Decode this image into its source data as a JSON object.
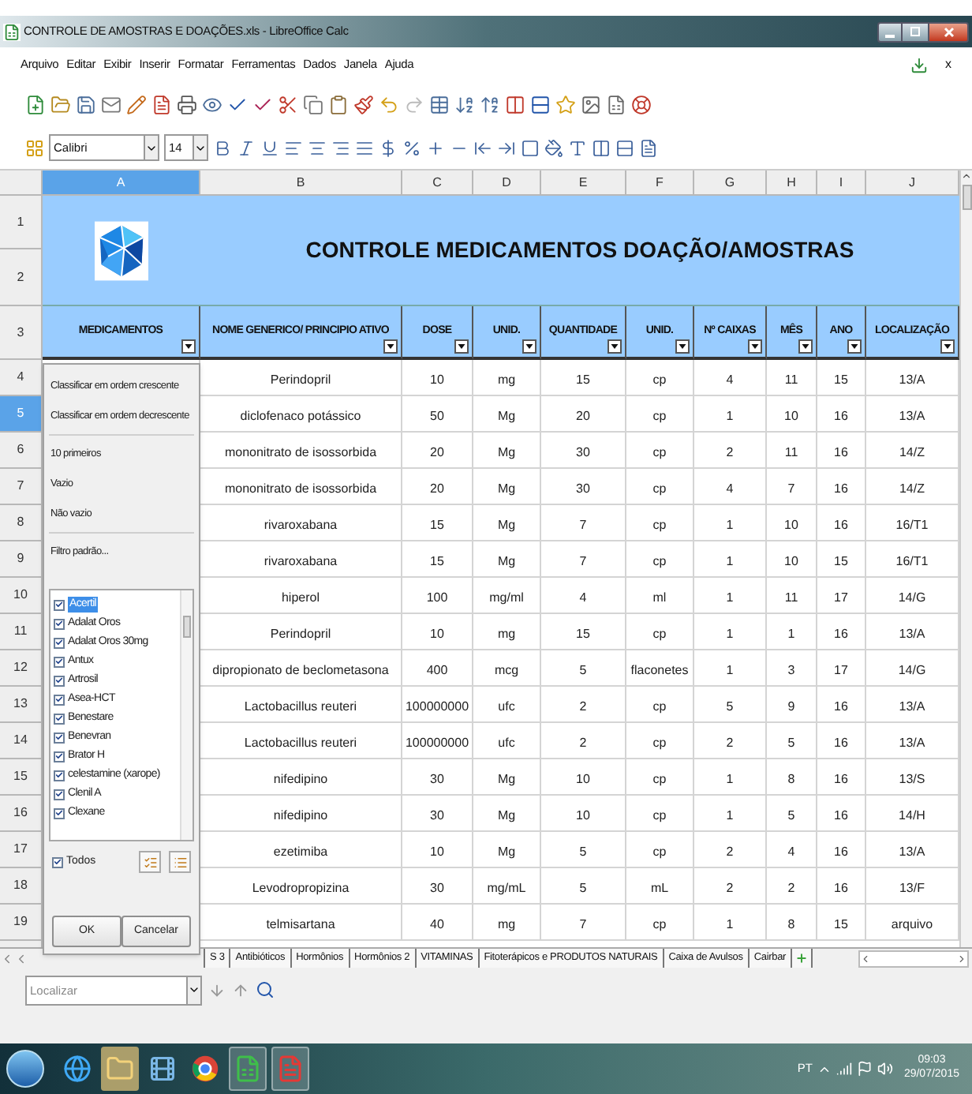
{
  "window": {
    "title": "CONTROLE DE AMOSTRAS E DOAÇÕES.xls - LibreOffice Calc"
  },
  "menu": [
    "Arquivo",
    "Editar",
    "Exibir",
    "Inserir",
    "Formatar",
    "Ferramentas",
    "Dados",
    "Janela",
    "Ajuda"
  ],
  "menu_close": "x",
  "formatting": {
    "font": "Calibri",
    "size": "14"
  },
  "columns": [
    {
      "label": "A",
      "selected": true
    },
    {
      "label": "B",
      "selected": false
    },
    {
      "label": "C",
      "selected": false
    },
    {
      "label": "D",
      "selected": false
    },
    {
      "label": "E",
      "selected": false
    },
    {
      "label": "F",
      "selected": false
    },
    {
      "label": "G",
      "selected": false
    },
    {
      "label": "H",
      "selected": false
    },
    {
      "label": "I",
      "selected": false
    },
    {
      "label": "J",
      "selected": false
    }
  ],
  "title_rows": [
    "1",
    "2"
  ],
  "sheet_title": "CONTROLE MEDICAMENTOS DOAÇÃO/AMOSTRAS",
  "header_row": {
    "num": "3",
    "labels": [
      "MEDICAMENTOS",
      "NOME GENERICO/ PRINCIPIO ATIVO",
      "DOSE",
      "UNID.",
      "QUANTIDADE",
      "UNID.",
      "Nº CAIXAS",
      "MÊS",
      "ANO",
      "LOCALIZAÇÃO"
    ]
  },
  "rows": [
    {
      "num": "4",
      "selected": false,
      "cells": [
        "Perindopril",
        "10",
        "mg",
        "15",
        "cp",
        "4",
        "11",
        "15",
        "13/A"
      ]
    },
    {
      "num": "5",
      "selected": true,
      "cells": [
        "diclofenaco potássico",
        "50",
        "Mg",
        "20",
        "cp",
        "1",
        "10",
        "16",
        "13/A"
      ]
    },
    {
      "num": "6",
      "selected": false,
      "cells": [
        "mononitrato de isossorbida",
        "20",
        "Mg",
        "30",
        "cp",
        "2",
        "11",
        "16",
        "14/Z"
      ]
    },
    {
      "num": "7",
      "selected": false,
      "cells": [
        "mononitrato de isossorbida",
        "20",
        "Mg",
        "30",
        "cp",
        "4",
        "7",
        "16",
        "14/Z"
      ]
    },
    {
      "num": "8",
      "selected": false,
      "cells": [
        "rivaroxabana",
        "15",
        "Mg",
        "7",
        "cp",
        "1",
        "10",
        "16",
        "16/T1"
      ]
    },
    {
      "num": "9",
      "selected": false,
      "cells": [
        "rivaroxabana",
        "15",
        "Mg",
        "7",
        "cp",
        "1",
        "10",
        "15",
        "16/T1"
      ]
    },
    {
      "num": "10",
      "selected": false,
      "cells": [
        "hiperol",
        "100",
        "mg/ml",
        "4",
        "ml",
        "1",
        "11",
        "17",
        "14/G"
      ]
    },
    {
      "num": "11",
      "selected": false,
      "cells": [
        "Perindopril",
        "10",
        "mg",
        "15",
        "cp",
        "1",
        "1",
        "16",
        "13/A"
      ]
    },
    {
      "num": "12",
      "selected": false,
      "cells": [
        "dipropionato de beclometasona",
        "400",
        "mcg",
        "5",
        "flaconetes",
        "1",
        "3",
        "17",
        "14/G"
      ]
    },
    {
      "num": "13",
      "selected": false,
      "cells": [
        "Lactobacillus reuteri",
        "100000000",
        "ufc",
        "2",
        "cp",
        "5",
        "9",
        "16",
        "13/A"
      ]
    },
    {
      "num": "14",
      "selected": false,
      "cells": [
        "Lactobacillus reuteri",
        "100000000",
        "ufc",
        "2",
        "cp",
        "2",
        "5",
        "16",
        "13/A"
      ]
    },
    {
      "num": "15",
      "selected": false,
      "cells": [
        "nifedipino",
        "30",
        "Mg",
        "10",
        "cp",
        "1",
        "8",
        "16",
        "13/S"
      ]
    },
    {
      "num": "16",
      "selected": false,
      "cells": [
        "nifedipino",
        "30",
        "Mg",
        "10",
        "cp",
        "1",
        "5",
        "16",
        "14/H"
      ]
    },
    {
      "num": "17",
      "selected": false,
      "cells": [
        "ezetimiba",
        "10",
        "Mg",
        "5",
        "cp",
        "2",
        "4",
        "16",
        "13/A"
      ]
    },
    {
      "num": "18",
      "selected": false,
      "cells": [
        "Levodropropizina",
        "30",
        "mg/mL",
        "5",
        "mL",
        "2",
        "2",
        "16",
        "13/F"
      ]
    },
    {
      "num": "19",
      "selected": false,
      "cells": [
        "telmisartana",
        "40",
        "mg",
        "7",
        "cp",
        "1",
        "8",
        "15",
        "arquivo"
      ]
    }
  ],
  "filter_popup": {
    "menu_sections": [
      [
        "Classificar em ordem crescente",
        "Classificar em ordem decrescente"
      ],
      [
        "10 primeiros",
        "Vazio",
        "Não vazio"
      ],
      [
        "Filtro padrão..."
      ]
    ],
    "items": [
      {
        "label": "Acertil",
        "checked": true,
        "selected": true
      },
      {
        "label": "Adalat Oros",
        "checked": true,
        "selected": false
      },
      {
        "label": "Adalat Oros 30mg",
        "checked": true,
        "selected": false
      },
      {
        "label": "Antux",
        "checked": true,
        "selected": false
      },
      {
        "label": "Artrosil",
        "checked": true,
        "selected": false
      },
      {
        "label": "Asea-HCT",
        "checked": true,
        "selected": false
      },
      {
        "label": "Benestare",
        "checked": true,
        "selected": false
      },
      {
        "label": "Benevran",
        "checked": true,
        "selected": false
      },
      {
        "label": "Brator H",
        "checked": true,
        "selected": false
      },
      {
        "label": "celestamine (xarope)",
        "checked": true,
        "selected": false
      },
      {
        "label": "Clenil A",
        "checked": true,
        "selected": false
      },
      {
        "label": "Clexane",
        "checked": true,
        "selected": false
      }
    ],
    "all": {
      "label": "Todos",
      "checked": true
    },
    "buttons": [
      "OK",
      "Cancelar"
    ]
  },
  "sheet_tabs": [
    {
      "label": "S 3",
      "selected": false
    },
    {
      "label": "Antibióticos",
      "selected": false
    },
    {
      "label": "Hormônios",
      "selected": false
    },
    {
      "label": "Hormônios 2",
      "selected": false
    },
    {
      "label": "VITAMINAS",
      "selected": false
    },
    {
      "label": "Fitoterápicos e PRODUTOS NATURAIS",
      "selected": false
    },
    {
      "label": "Caixa de Avulsos",
      "selected": false
    },
    {
      "label": "Cairbar",
      "selected": false
    }
  ],
  "find": {
    "placeholder": "Localizar"
  },
  "taskbar": {
    "language": "PT",
    "time": "09:03",
    "date": "29/07/2015"
  }
}
